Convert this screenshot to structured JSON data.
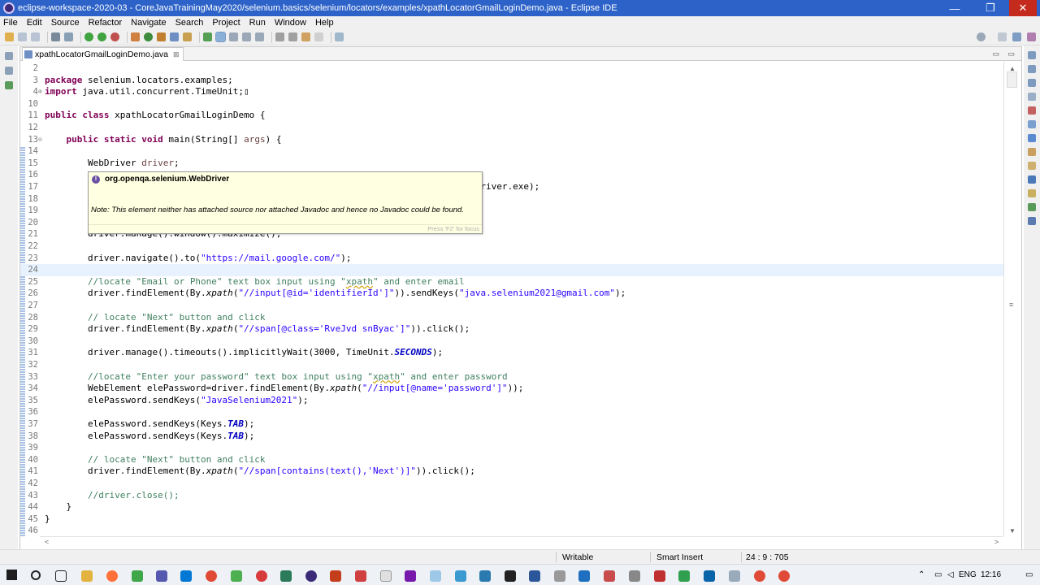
{
  "window": {
    "title": "eclipse-workspace-2020-03 - CoreJavaTrainingMay2020/selenium.basics/selenium/locators/examples/xpathLocatorGmailLoginDemo.java - Eclipse IDE",
    "minimize": "—",
    "maximize": "❐",
    "close": "✕"
  },
  "menu": [
    "File",
    "Edit",
    "Source",
    "Refactor",
    "Navigate",
    "Search",
    "Project",
    "Run",
    "Window",
    "Help"
  ],
  "editor": {
    "tab_label": "xpathLocatorGmailLoginDemo.java",
    "tab_close": "⊠",
    "tab_controls": "▭ ▭"
  },
  "code_lines": [
    {
      "n": "2",
      "fold": "",
      "t": ""
    },
    {
      "n": "3",
      "fold": "",
      "t": "package selenium.locators.examples;"
    },
    {
      "n": "4",
      "fold": "⊕",
      "t": "import java.util.concurrent.TimeUnit;▯"
    },
    {
      "n": "10",
      "fold": "",
      "t": ""
    },
    {
      "n": "11",
      "fold": "",
      "t": "public class xpathLocatorGmailLoginDemo {"
    },
    {
      "n": "12",
      "fold": "",
      "t": ""
    },
    {
      "n": "13",
      "fold": "⊖",
      "t": "    public static void main(String[] args) {"
    },
    {
      "n": "14",
      "fold": "",
      "t": ""
    },
    {
      "n": "15",
      "fold": "",
      "t": "        WebDriver driver;"
    },
    {
      "n": "16",
      "fold": "",
      "t": ""
    },
    {
      "n": "17",
      "fold": "",
      "t": "                                                                                 river.exe\");"
    },
    {
      "n": "18",
      "fold": "",
      "t": ""
    },
    {
      "n": "19",
      "fold": "",
      "t": ""
    },
    {
      "n": "20",
      "fold": "",
      "t": ""
    },
    {
      "n": "21",
      "fold": "",
      "t": "        driver.manage().window().maximize();"
    },
    {
      "n": "22",
      "fold": "",
      "t": ""
    },
    {
      "n": "23",
      "fold": "",
      "t": "        driver.navigate().to(\"https://mail.google.com/\");"
    },
    {
      "n": "24",
      "fold": "",
      "t": ""
    },
    {
      "n": "25",
      "fold": "",
      "t": "        //locate \"Email or Phone\" text box input using \"xpath\" and enter email"
    },
    {
      "n": "26",
      "fold": "",
      "t": "        driver.findElement(By.xpath(\"//input[@id='identifierId']\")).sendKeys(\"java.selenium2021@gmail.com\");"
    },
    {
      "n": "27",
      "fold": "",
      "t": ""
    },
    {
      "n": "28",
      "fold": "",
      "t": "        // locate \"Next\" button and click"
    },
    {
      "n": "29",
      "fold": "",
      "t": "        driver.findElement(By.xpath(\"//span[@class='RveJvd snByac']\")).click();"
    },
    {
      "n": "30",
      "fold": "",
      "t": ""
    },
    {
      "n": "31",
      "fold": "",
      "t": "        driver.manage().timeouts().implicitlyWait(3000, TimeUnit.SECONDS);"
    },
    {
      "n": "32",
      "fold": "",
      "t": ""
    },
    {
      "n": "33",
      "fold": "",
      "t": "        //locate \"Enter your password\" text box input using \"xpath\" and enter password"
    },
    {
      "n": "34",
      "fold": "",
      "t": "        WebElement elePassword=driver.findElement(By.xpath(\"//input[@name='password']\"));"
    },
    {
      "n": "35",
      "fold": "",
      "t": "        elePassword.sendKeys(\"JavaSelenium2021\");"
    },
    {
      "n": "36",
      "fold": "",
      "t": ""
    },
    {
      "n": "37",
      "fold": "",
      "t": "        elePassword.sendKeys(Keys.TAB);"
    },
    {
      "n": "38",
      "fold": "",
      "t": "        elePassword.sendKeys(Keys.TAB);"
    },
    {
      "n": "39",
      "fold": "",
      "t": ""
    },
    {
      "n": "40",
      "fold": "",
      "t": "        // locate \"Next\" button and click"
    },
    {
      "n": "41",
      "fold": "",
      "t": "        driver.findElement(By.xpath(\"//span[contains(text(),'Next')]\")).click();"
    },
    {
      "n": "42",
      "fold": "",
      "t": ""
    },
    {
      "n": "43",
      "fold": "",
      "t": "        //driver.close();"
    },
    {
      "n": "44",
      "fold": "",
      "t": "    }"
    },
    {
      "n": "45",
      "fold": "",
      "t": "}"
    },
    {
      "n": "46",
      "fold": "",
      "t": ""
    }
  ],
  "current_line": "24",
  "hover": {
    "header": "org.openqa.selenium.WebDriver",
    "note": "Note: This element neither has attached source nor attached Javadoc and hence no Javadoc could be found.",
    "footer": "Press 'F2' for focus"
  },
  "status": {
    "writable": "Writable",
    "insert_mode": "Smart Insert",
    "position": "24 : 9 : 705"
  },
  "taskbar": {
    "lang": "ENG",
    "time": "12:16"
  }
}
